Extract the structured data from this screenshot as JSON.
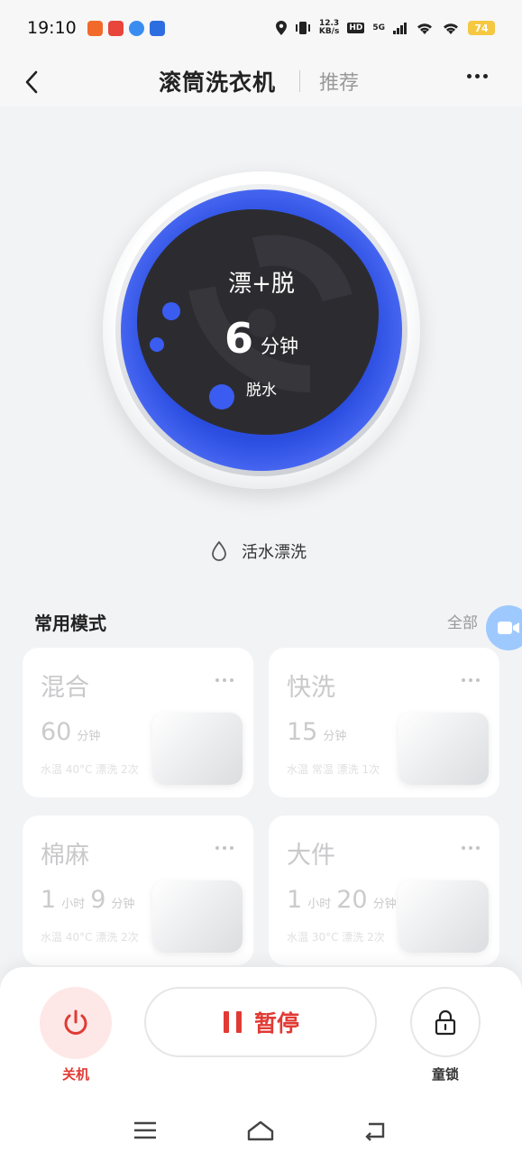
{
  "status_bar": {
    "time": "19:10",
    "network_speed_value": "12.3",
    "network_speed_unit": "KB/s",
    "hd_label": "HD",
    "signal_label": "5G",
    "battery": "74"
  },
  "header": {
    "title": "滚筒洗衣机",
    "recommend": "推荐"
  },
  "drum": {
    "mode": "漂+脱",
    "time_value": "6",
    "time_unit": "分钟",
    "stage": "脱水"
  },
  "rinse_option": "活水漂洗",
  "modes_section": {
    "title": "常用模式",
    "all_link": "全部",
    "cards": [
      {
        "name": "混合",
        "time_value": "60",
        "time_unit": "分钟",
        "info": "水温 40°C 漂洗 2次"
      },
      {
        "name": "快洗",
        "time_value": "15",
        "time_unit": "分钟",
        "info": "水温 常温 漂洗 1次"
      },
      {
        "name": "棉麻",
        "time_h": "1",
        "time_h_unit": "小时",
        "time_m": "9",
        "time_m_unit": "分钟",
        "info": "水温 40°C 漂洗 2次"
      },
      {
        "name": "大件",
        "time_h": "1",
        "time_h_unit": "小时",
        "time_m": "20",
        "time_m_unit": "分钟",
        "info": "水温 30°C 漂洗 2次"
      }
    ]
  },
  "controls": {
    "power_label": "关机",
    "pause_label": "暂停",
    "lock_label": "童锁"
  },
  "colors": {
    "accent_red": "#e13a34",
    "drum_blue": "#2a4de0"
  }
}
